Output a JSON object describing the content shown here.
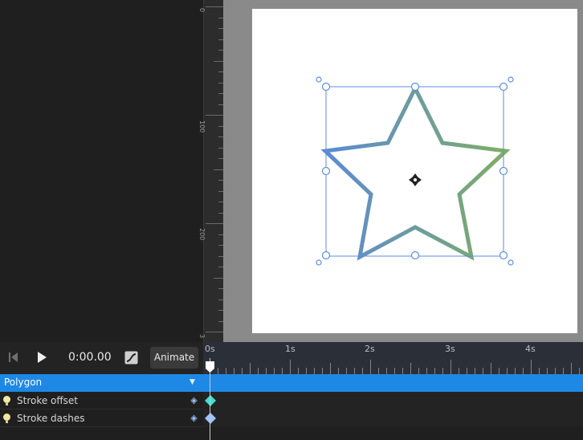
{
  "ruler": {
    "labels": [
      "0",
      "100",
      "200",
      "3"
    ]
  },
  "controls": {
    "time": "0:00.00",
    "animate_label": "Animate"
  },
  "timeline": {
    "ticks": [
      "0s",
      "1s",
      "2s",
      "3s",
      "4s"
    ]
  },
  "layer": {
    "name": "Polygon"
  },
  "properties": [
    {
      "label": "Stroke offset",
      "keyframe_color": "#3fe0d0"
    },
    {
      "label": "Stroke dashes",
      "keyframe_color": "#9cc4ff"
    }
  ],
  "colors": {
    "accent": "#1e88e5",
    "selection": "#5b8ee0",
    "star_gradient_start": "#5b8ad6",
    "star_gradient_end": "#7fae64"
  },
  "icons": [
    "skip-start-icon",
    "play-icon",
    "curve-editor-icon",
    "bulb-icon",
    "add-keyframe-icon",
    "move-cursor-icon"
  ]
}
